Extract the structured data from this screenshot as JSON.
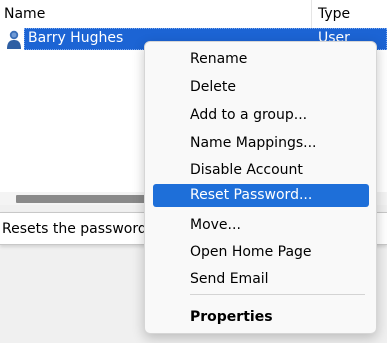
{
  "list": {
    "columns": {
      "name": "Name",
      "type": "Type"
    },
    "row": {
      "name": "Barry Hughes",
      "type": "User",
      "icon": "user-icon"
    }
  },
  "statusbar": {
    "text": "Resets the password fo"
  },
  "context_menu": {
    "items": [
      {
        "label": "Rename"
      },
      {
        "label": "Delete"
      },
      {
        "label": "Add to a group..."
      },
      {
        "label": "Name Mappings..."
      },
      {
        "label": "Disable Account"
      },
      {
        "label": "Reset Password...",
        "highlighted": true
      },
      {
        "label": "Move..."
      },
      {
        "label": "Open Home Page"
      },
      {
        "label": "Send Email"
      },
      {
        "label": "Properties",
        "bold": true
      }
    ]
  },
  "colors": {
    "selection": "#1c64d4",
    "menu_highlight": "#1e6fd9",
    "menu_background": "#f9f9f9"
  }
}
